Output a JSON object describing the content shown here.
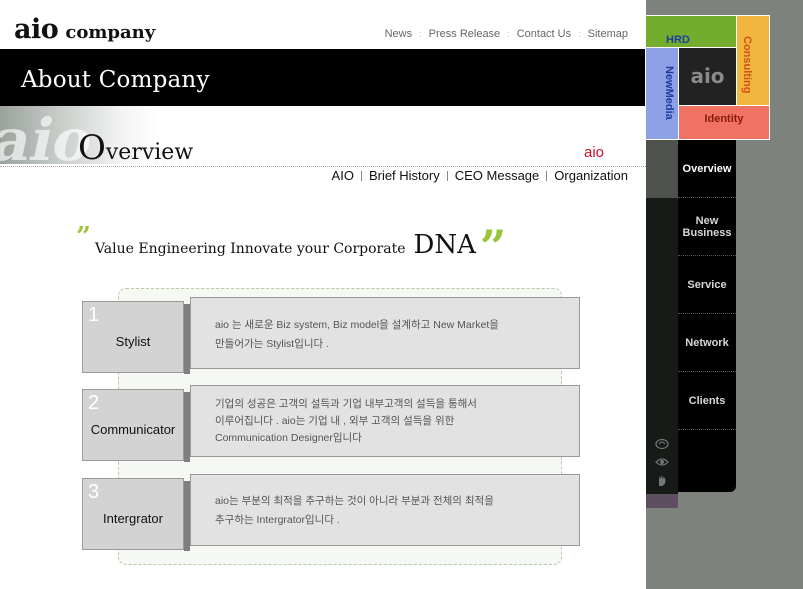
{
  "header": {
    "logo_main": "aio",
    "logo_sub": "company",
    "nav": [
      "News",
      "Press Release",
      "Contact Us",
      "Sitemap"
    ]
  },
  "banner": {
    "title": "About Company"
  },
  "section": {
    "title_cap": "O",
    "title_rest": "verview",
    "brand": "aio"
  },
  "subnav": [
    "AIO",
    "Brief History",
    "CEO Message",
    "Organization"
  ],
  "tagline": {
    "quote_open": "”",
    "text": "Value Engineering Innovate your Corporate",
    "emph": "DNA",
    "quote_close": "”"
  },
  "cards": [
    {
      "num": "1",
      "label": "Stylist",
      "lines": [
        "aio 는 새로운 Biz system, Biz model을 설계하고 New Market을",
        "만들어가는 Stylist입니다 ."
      ]
    },
    {
      "num": "2",
      "label": "Communicator",
      "lines": [
        "기업의 성공은 고객의 설득과 기업 내부고객의 설득을 통해서",
        "이루어집니다 . aio는 기업 내 , 외부 고객의 설득을 위한",
        "Communication Designer입니다"
      ]
    },
    {
      "num": "3",
      "label": "Intergrator",
      "lines": [
        "aio는 부분의 최적을 추구하는 것이 아니라 부분과 전체의 최적을",
        "추구하는 Intergrator입니다 ."
      ]
    }
  ],
  "grid": {
    "hrd": "HRD",
    "consulting": "Consulting",
    "newmedia": "NewMedia",
    "center": "aio",
    "identity": "Identity"
  },
  "sidemenu": [
    {
      "label": "Overview",
      "active": true
    },
    {
      "label": "New\nBusiness"
    },
    {
      "label": "Service"
    },
    {
      "label": "Network"
    },
    {
      "label": "Clients"
    }
  ],
  "icons": [
    "ear-icon",
    "eye-icon",
    "hand-icon"
  ],
  "colors": {
    "accent_green": "#9bc43d",
    "brand_red": "#c8102e",
    "hrd": "#74ad2d",
    "consulting": "#f2b53d",
    "newmedia": "#8ea0e6",
    "identity": "#f07263"
  }
}
